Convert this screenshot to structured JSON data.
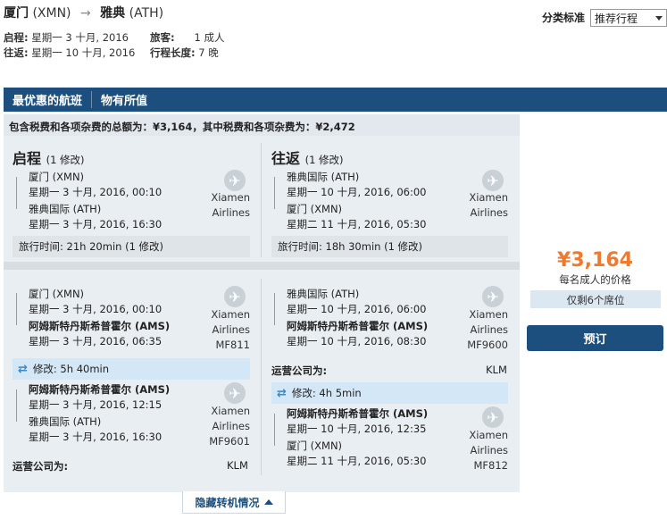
{
  "header": {
    "origin": "厦门",
    "origin_code": "(XMN)",
    "destination": "雅典",
    "destination_code": "(ATH)",
    "depart_label": "启程:",
    "depart_date": "星期一 3 十月, 2016",
    "return_label": "往返:",
    "return_date": "星期一 10 十月, 2016",
    "travelers_label": "旅客:",
    "travelers_value": "1 成人",
    "duration_label": "行程长度:",
    "duration_value": "7 晚"
  },
  "sort": {
    "label": "分类标准",
    "value": "推荐行程"
  },
  "tabs": [
    "最优惠的航班",
    "物有所值"
  ],
  "total_note": "包含税费和各项杂费的总额为：¥3,164，其中税费和各项杂费为：¥2,472",
  "summary": {
    "outbound": {
      "title": "启程",
      "changes": "(1 修改)",
      "from": "厦门 (XMN)",
      "from_time": "星期一 3 十月, 2016, 00:10",
      "to": "雅典国际 (ATH)",
      "to_time": "星期一 3 十月, 2016, 16:30",
      "airline1": "Xiamen",
      "airline2": "Airlines",
      "duration": "旅行时间: 21h 20min (1 修改)"
    },
    "inbound": {
      "title": "往返",
      "changes": "(1 修改)",
      "from": "雅典国际 (ATH)",
      "from_time": "星期一 10 十月, 2016, 06:00",
      "to": "厦门 (XMN)",
      "to_time": "星期二 11 十月, 2016, 05:30",
      "airline1": "Xiamen",
      "airline2": "Airlines",
      "duration": "旅行时间: 18h 30min (1 修改)"
    }
  },
  "details": {
    "outbound": {
      "seg1": {
        "from": "厦门 (XMN)",
        "from_time": "星期一 3 十月, 2016, 00:10",
        "to": "阿姆斯特丹斯希普霍尔 (AMS)",
        "to_time": "星期一 3 十月, 2016, 06:35",
        "airline1": "Xiamen",
        "airline2": "Airlines",
        "flight": "MF811"
      },
      "layover": "修改: 5h 40min",
      "seg2": {
        "from": "阿姆斯特丹斯希普霍尔 (AMS)",
        "from_time": "星期一 3 十月, 2016, 12:15",
        "to": "雅典国际 (ATH)",
        "to_time": "星期一 3 十月, 2016, 16:30",
        "airline1": "Xiamen",
        "airline2": "Airlines",
        "flight": "MF9601"
      },
      "operator_label": "运营公司为:",
      "operator": "KLM"
    },
    "inbound": {
      "seg1": {
        "from": "雅典国际 (ATH)",
        "from_time": "星期一 10 十月, 2016, 06:00",
        "to": "阿姆斯特丹斯希普霍尔 (AMS)",
        "to_time": "星期一 10 十月, 2016, 08:30",
        "airline1": "Xiamen",
        "airline2": "Airlines",
        "flight": "MF9600"
      },
      "operator_label": "运营公司为:",
      "operator": "KLM",
      "layover": "修改: 4h 5min",
      "seg2": {
        "from": "阿姆斯特丹斯希普霍尔 (AMS)",
        "from_time": "星期一 10 十月, 2016, 12:35",
        "to": "厦门 (XMN)",
        "to_time": "星期二 11 十月, 2016, 05:30",
        "airline1": "Xiamen",
        "airline2": "Airlines",
        "flight": "MF812"
      }
    }
  },
  "price": {
    "amount": "¥3,164",
    "per": "每名成人的价格",
    "seats": "仅剩6个席位",
    "book": "预订"
  },
  "toggle_label": "隐藏转机情况",
  "colors": {
    "brand": "#1c4f7d",
    "price": "#ee7a30",
    "panel": "#e9eef3"
  }
}
